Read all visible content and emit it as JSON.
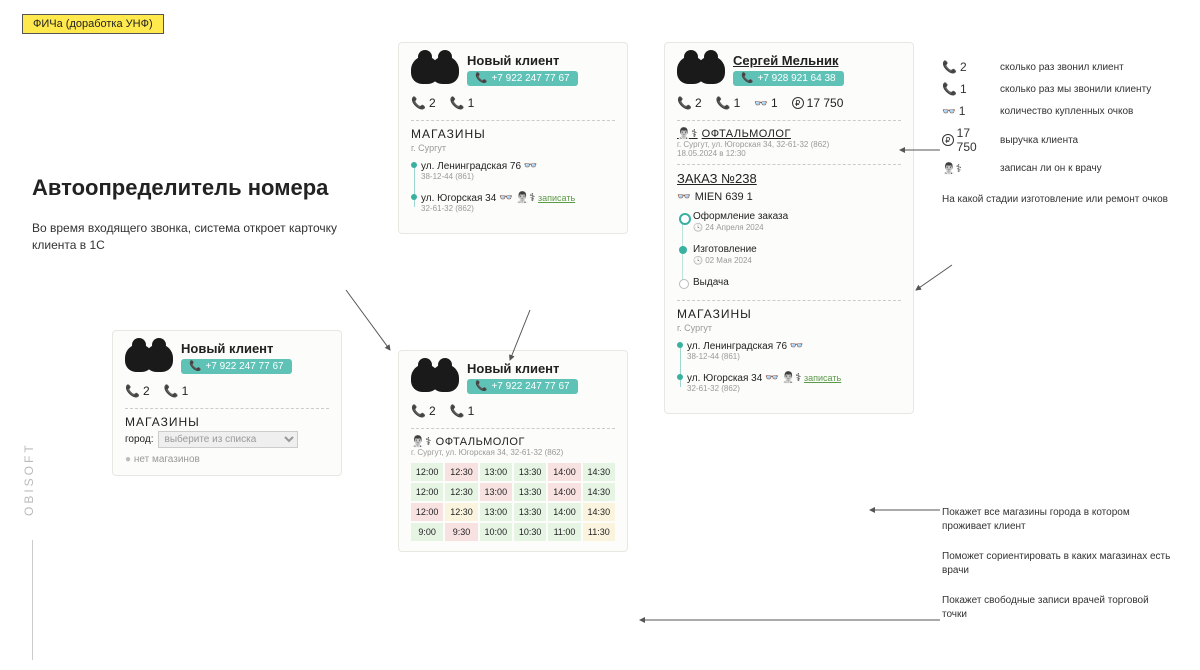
{
  "badge": "ФИЧа (доработка УНФ)",
  "heading": "Автоопределитель номера",
  "subheading": "Во время входящего звонка, система откроет карточку клиента в 1С",
  "brand": "OBISOFT",
  "card_small": {
    "name": "Новый клиент",
    "phone": "+7 922 247 77 67",
    "calls_in": "2",
    "calls_out": "1",
    "shops_title": "МАГАЗИНЫ",
    "city_label": "город:",
    "city_placeholder": "выберите из списка",
    "no_shops": "нет магазинов"
  },
  "card_mid_top": {
    "name": "Новый клиент",
    "phone": "+7 922 247 77 67",
    "calls_in": "2",
    "calls_out": "1",
    "shops_title": "МАГАЗИНЫ",
    "city": "г. Сургут",
    "shop1_addr": "ул. Ленинградская 76",
    "shop1_meta": "38-12-44 (861)",
    "shop2_addr": "ул. Югорская 34",
    "shop2_meta": "32-61-32 (862)",
    "book": "записать"
  },
  "card_mid_bot": {
    "name": "Новый клиент",
    "phone": "+7 922 247 77 67",
    "calls_in": "2",
    "calls_out": "1",
    "doc_title": "ОФТАЛЬМОЛОГ",
    "doc_sub": "г. Сургут, ул. Югорская 34, 32-61-32 (862)",
    "slots": [
      {
        "t": "12:00",
        "c": "g"
      },
      {
        "t": "12:30",
        "c": "r"
      },
      {
        "t": "13:00",
        "c": "g"
      },
      {
        "t": "13:30",
        "c": "g"
      },
      {
        "t": "14:00",
        "c": "r"
      },
      {
        "t": "14:30",
        "c": "g"
      },
      {
        "t": "12:00",
        "c": "g"
      },
      {
        "t": "12:30",
        "c": "g"
      },
      {
        "t": "13:00",
        "c": "r"
      },
      {
        "t": "13:30",
        "c": "g"
      },
      {
        "t": "14:00",
        "c": "r"
      },
      {
        "t": "14:30",
        "c": "g"
      },
      {
        "t": "12:00",
        "c": "r"
      },
      {
        "t": "12:30",
        "c": "y"
      },
      {
        "t": "13:00",
        "c": "g"
      },
      {
        "t": "13:30",
        "c": "g"
      },
      {
        "t": "14:00",
        "c": "g"
      },
      {
        "t": "14:30",
        "c": "y"
      },
      {
        "t": "9:00",
        "c": "g"
      },
      {
        "t": "9:30",
        "c": "r"
      },
      {
        "t": "10:00",
        "c": "g"
      },
      {
        "t": "10:30",
        "c": "g"
      },
      {
        "t": "11:00",
        "c": "g"
      },
      {
        "t": "11:30",
        "c": "y"
      }
    ]
  },
  "card_large": {
    "name": "Сергей Мельник",
    "phone": "+7 928 921 64 38",
    "calls_in": "2",
    "calls_out": "1",
    "glasses": "1",
    "revenue": "17 750",
    "doc_title": "ОФТАЛЬМОЛОГ",
    "doc_sub": "г. Сургут, ул. Югорская 34, 32-61-32 (862)",
    "doc_date": "18.05.2024 в 12:30",
    "order_title": "ЗАКАЗ №238",
    "order_product": "MIEN 639 1",
    "tl1": "Оформление заказа",
    "tl1_date": "24 Апреля 2024",
    "tl2": "Изготовление",
    "tl2_date": "02 Мая 2024",
    "tl3": "Выдача",
    "shops_title": "МАГАЗИНЫ",
    "city": "г. Сургут",
    "shop1_addr": "ул. Ленинградская 76",
    "shop1_meta": "38-12-44 (861)",
    "shop2_addr": "ул. Югорская 34",
    "shop2_meta": "32-61-32 (862)",
    "book": "записать"
  },
  "legend": {
    "l1": "сколько раз звонил клиент",
    "l1v": "2",
    "l2": "сколько раз мы звонили клиенту",
    "l2v": "1",
    "l3": "количество купленных очков",
    "l3v": "1",
    "l4": "выручка клиента",
    "l4v": "17 750",
    "l5": "записан ли он к врачу",
    "note1": "На какой стадии изготовление или ремонт очков",
    "note2": "Покажет все магазины города в котором проживает клиент",
    "note3": "Поможет сориентировать в каких магазинах есть врачи",
    "note4": "Покажет свободные записи врачей торговой точки"
  }
}
